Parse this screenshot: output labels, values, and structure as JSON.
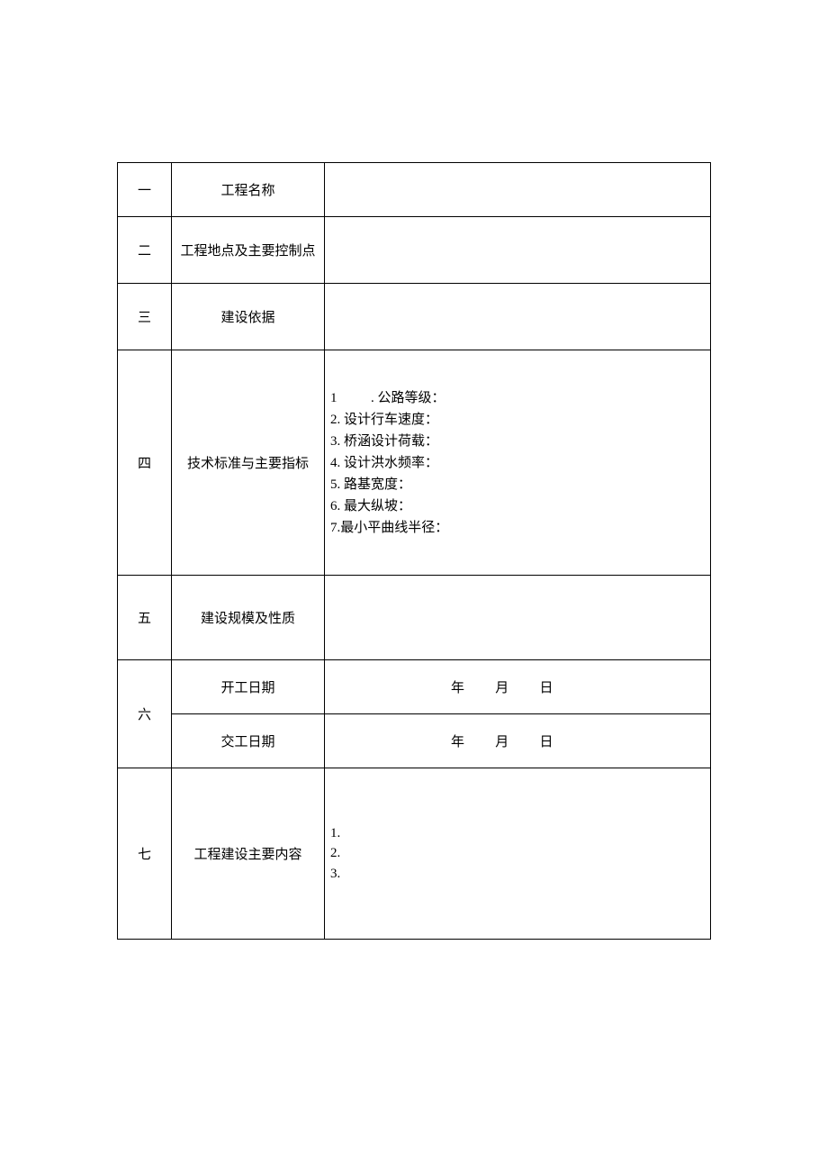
{
  "rows": {
    "r1": {
      "num": "一",
      "label": "工程名称",
      "content": ""
    },
    "r2": {
      "num": "二",
      "label": "工程地点及主要控制点",
      "content": ""
    },
    "r3": {
      "num": "三",
      "label": "建设依据",
      "content": ""
    },
    "r4": {
      "num": "四",
      "label": "技术标准与主要指标",
      "lines": {
        "l1": "1          . 公路等级：",
        "l2": "2. 设计行车速度：",
        "l3": "3. 桥涵设计荷载：",
        "l4": "4. 设计洪水频率：",
        "l5": "5. 路基宽度：",
        "l6": "6. 最大纵坡：",
        "l7": "7.最小平曲线半径："
      }
    },
    "r5": {
      "num": "五",
      "label": "建设规模及性质",
      "content": ""
    },
    "r6": {
      "num": "六",
      "label_start": "开工日期",
      "label_end": "交工日期",
      "date_start": "年       月       日",
      "date_end": "年       月       日"
    },
    "r7": {
      "num": "七",
      "label": "工程建设主要内容",
      "lines": {
        "l1": "1.",
        "l2": "2.",
        "l3": "3."
      }
    }
  }
}
